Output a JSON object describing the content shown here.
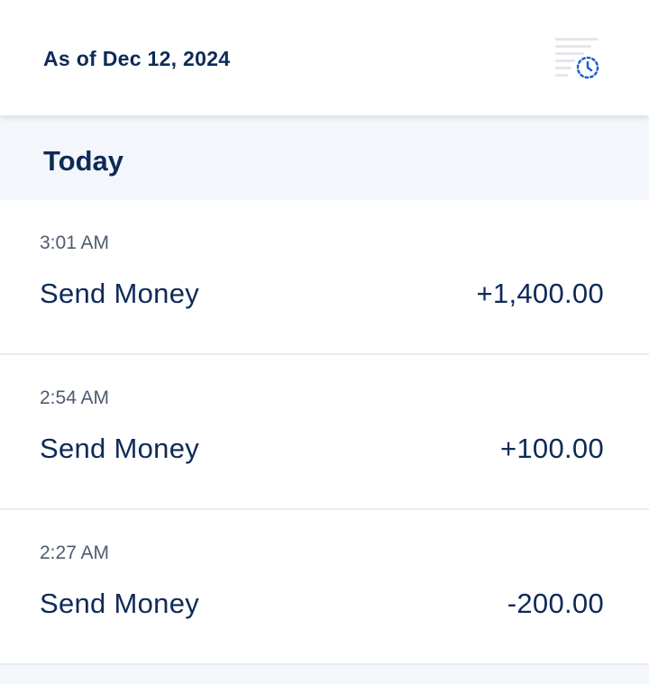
{
  "header": {
    "as_of": "As of Dec 12, 2024",
    "history_icon": "transaction-history-clock-icon",
    "icon_color": "#1a5fd6"
  },
  "section": {
    "title": "Today"
  },
  "transactions": [
    {
      "time": "3:01 AM",
      "name": "Send Money",
      "amount": "+1,400.00"
    },
    {
      "time": "2:54 AM",
      "name": "Send Money",
      "amount": "+100.00"
    },
    {
      "time": "2:27 AM",
      "name": "Send Money",
      "amount": "-200.00"
    }
  ],
  "colors": {
    "text_primary": "#0e2a57",
    "text_secondary": "#4d5b70",
    "section_background": "#f3f7fc"
  }
}
